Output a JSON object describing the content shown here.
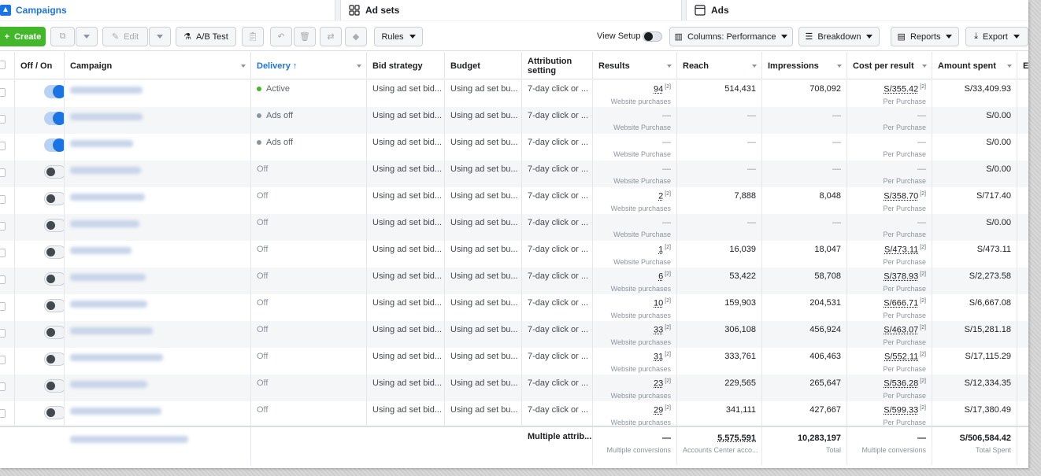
{
  "tabs": {
    "campaigns": "Campaigns",
    "adsets": "Ad sets",
    "ads": "Ads"
  },
  "toolbar": {
    "create": "Create",
    "edit": "Edit",
    "ab_test": "A/B Test",
    "rules": "Rules",
    "view_setup": "View Setup",
    "columns": "Columns: Performance",
    "breakdown": "Breakdown",
    "reports": "Reports",
    "export": "Export"
  },
  "headers": {
    "off_on": "Off / On",
    "campaign": "Campaign",
    "delivery": "Delivery ↑",
    "bid": "Bid strategy",
    "budget": "Budget",
    "attribution": "Attribution setting",
    "results": "Results",
    "reach": "Reach",
    "impressions": "Impressions",
    "cpr": "Cost per result",
    "amount": "Amount spent",
    "extra": "En"
  },
  "rows": [
    {
      "on": true,
      "delivery": "Active",
      "bid": "Using ad set bid...",
      "budget": "Using ad set bu...",
      "attr": "7-day click or ...",
      "results": "94",
      "results_sub": "Website purchases",
      "reach": "514,431",
      "impr": "708,092",
      "cpr": "S/355.42",
      "cpr_sub": "Per Purchase",
      "spent": "S/33,409.93"
    },
    {
      "on": true,
      "delivery": "Ads off",
      "bid": "Using ad set bid...",
      "budget": "Using ad set bu...",
      "attr": "7-day click or ...",
      "results": "—",
      "results_sub": "Website Purchase",
      "reach": "—",
      "impr": "—",
      "cpr": "—",
      "cpr_sub": "Per Purchase",
      "spent": "S/0.00"
    },
    {
      "on": true,
      "delivery": "Ads off",
      "bid": "Using ad set bid...",
      "budget": "Using ad set bu...",
      "attr": "7-day click or ...",
      "results": "—",
      "results_sub": "Website Purchase",
      "reach": "—",
      "impr": "—",
      "cpr": "—",
      "cpr_sub": "Per Purchase",
      "spent": "S/0.00"
    },
    {
      "on": false,
      "delivery": "Off",
      "bid": "Using ad set bid...",
      "budget": "Using ad set bu...",
      "attr": "7-day click or ...",
      "results": "—",
      "results_sub": "Website Purchase",
      "reach": "—",
      "impr": "—",
      "cpr": "—",
      "cpr_sub": "Per Purchase",
      "spent": "S/0.00"
    },
    {
      "on": false,
      "delivery": "Off",
      "bid": "Using ad set bid...",
      "budget": "Using ad set bu...",
      "attr": "7-day click or ...",
      "results": "2",
      "results_sub": "Website purchases",
      "reach": "7,888",
      "impr": "8,048",
      "cpr": "S/358.70",
      "cpr_sub": "Per Purchase",
      "spent": "S/717.40"
    },
    {
      "on": false,
      "delivery": "Off",
      "bid": "Using ad set bid...",
      "budget": "Using ad set bu...",
      "attr": "7-day click or ...",
      "results": "—",
      "results_sub": "Website Purchase",
      "reach": "—",
      "impr": "—",
      "cpr": "—",
      "cpr_sub": "Per Purchase",
      "spent": "S/0.00"
    },
    {
      "on": false,
      "delivery": "Off",
      "bid": "Using ad set bid...",
      "budget": "Using ad set bu...",
      "attr": "7-day click or ...",
      "results": "1",
      "results_sub": "Website Purchase",
      "reach": "16,039",
      "impr": "18,047",
      "cpr": "S/473.11",
      "cpr_sub": "Per Purchase",
      "spent": "S/473.11"
    },
    {
      "on": false,
      "delivery": "Off",
      "bid": "Using ad set bid...",
      "budget": "Using ad set bu...",
      "attr": "7-day click or ...",
      "results": "6",
      "results_sub": "Website purchases",
      "reach": "53,422",
      "impr": "58,708",
      "cpr": "S/378.93",
      "cpr_sub": "Per Purchase",
      "spent": "S/2,273.58"
    },
    {
      "on": false,
      "delivery": "Off",
      "bid": "Using ad set bid...",
      "budget": "Using ad set bu...",
      "attr": "7-day click or ...",
      "results": "10",
      "results_sub": "Website purchases",
      "reach": "159,903",
      "impr": "204,531",
      "cpr": "S/666.71",
      "cpr_sub": "Per Purchase",
      "spent": "S/6,667.08"
    },
    {
      "on": false,
      "delivery": "Off",
      "bid": "Using ad set bid...",
      "budget": "Using ad set bu...",
      "attr": "7-day click or ...",
      "results": "33",
      "results_sub": "Website purchases",
      "reach": "306,108",
      "impr": "456,924",
      "cpr": "S/463.07",
      "cpr_sub": "Per Purchase",
      "spent": "S/15,281.18"
    },
    {
      "on": false,
      "delivery": "Off",
      "bid": "Using ad set bid...",
      "budget": "Using ad set bu...",
      "attr": "7-day click or ...",
      "results": "31",
      "results_sub": "Website purchases",
      "reach": "333,761",
      "impr": "406,463",
      "cpr": "S/552.11",
      "cpr_sub": "Per Purchase",
      "spent": "S/17,115.29"
    },
    {
      "on": false,
      "delivery": "Off",
      "bid": "Using ad set bid...",
      "budget": "Using ad set bu...",
      "attr": "7-day click or ...",
      "results": "23",
      "results_sub": "Website purchases",
      "reach": "229,565",
      "impr": "265,647",
      "cpr": "S/536.28",
      "cpr_sub": "Per Purchase",
      "spent": "S/12,334.35"
    },
    {
      "on": false,
      "delivery": "Off",
      "bid": "Using ad set bid...",
      "budget": "Using ad set bu...",
      "attr": "7-day click or ...",
      "results": "29",
      "results_sub": "Website purchases",
      "reach": "341,111",
      "impr": "427,667",
      "cpr": "S/599.33",
      "cpr_sub": "Per Purchase",
      "spent": "S/17,380.49"
    }
  ],
  "totals": {
    "attr": "Multiple attrib...",
    "results": "—",
    "results_sub": "Multiple conversions",
    "reach": "5,575,591",
    "reach_sub": "Accounts Center acco...",
    "impr": "10,283,197",
    "impr_sub": "Total",
    "cpr": "—",
    "cpr_sub": "Multiple conversions",
    "spent": "S/506,584.42",
    "spent_sub": "Total Spent"
  },
  "colors": {
    "accent": "#1b74e4",
    "create": "#42b72a",
    "active_dot": "#42b72a",
    "off_dot": "#8d949e"
  }
}
